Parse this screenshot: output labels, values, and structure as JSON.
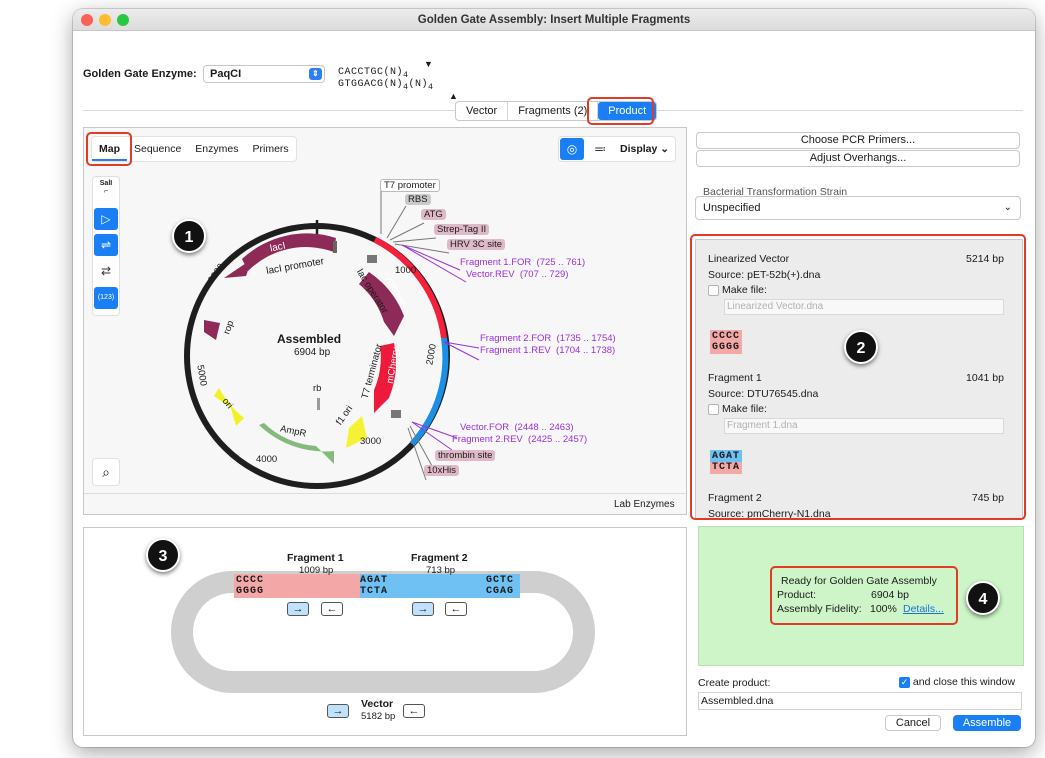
{
  "window": {
    "title": "Golden Gate Assembly: Insert Multiple Fragments"
  },
  "enzyme": {
    "label": "Golden Gate Enzyme:",
    "value": "PaqCI",
    "site_top": "CACCTGC(N)",
    "site_top_sub": "4",
    "site_bottom": "GTGGACG(N)",
    "site_bottom_sub1": "4",
    "site_bottom_mid": "(N)",
    "site_bottom_sub2": "4"
  },
  "main_tabs": [
    "Vector",
    "Fragments (2)",
    "Product"
  ],
  "view_tabs": [
    "Map",
    "Sequence",
    "Enzymes",
    "Primers"
  ],
  "display_label": "Display",
  "side_tools": {
    "sali": "SalI",
    "counter": "(123)"
  },
  "map": {
    "name": "Assembled",
    "length": "6904 bp",
    "ticks": [
      "1000",
      "2000",
      "3000",
      "4000",
      "5000",
      "6000"
    ],
    "features": {
      "laci": "lacI",
      "laci_promoter": "lacI promoter",
      "lac_operator": "lac operator",
      "xynbmat": "xynBmat",
      "mcherry": "mCherry",
      "t7_terminator": "T7 terminator",
      "f1_ori": "f1 ori",
      "ampr": "AmpR",
      "ori": "ori",
      "rop": "rop",
      "rb": "rb"
    },
    "labels_boxed": [
      "T7 promoter",
      "RBS",
      "ATG",
      "Strep-Tag II",
      "HRV 3C site",
      "thrombin site",
      "10xHis"
    ],
    "primers": [
      "Fragment 1.FOR  (725 .. 761)",
      "Vector.REV  (707 .. 729)",
      "Fragment 2.FOR  (1735 .. 1754)",
      "Fragment 1.REV  (1704 .. 1738)",
      "Vector.FOR  (2448 .. 2463)",
      "Fragment 2.REV  (2425 .. 2457)"
    ],
    "footer": "Lab Enzymes"
  },
  "right": {
    "choose_primers": "Choose PCR Primers...",
    "adjust_overhangs": "Adjust Overhangs...",
    "strain_label": "Bacterial Transformation Strain",
    "strain_value": "Unspecified"
  },
  "fragments": [
    {
      "title": "Linearized Vector",
      "size": "5214 bp",
      "source_label": "Source:",
      "source": "pET-52b(+).dna",
      "make_file": "Make file:",
      "filename": "Linearized Vector.dna",
      "overhang_top": "CCCC",
      "overhang_bottom": "GGGG",
      "color": "#f4a7a7"
    },
    {
      "title": "Fragment 1",
      "size": "1041 bp",
      "source_label": "Source:",
      "source": "DTU76545.dna",
      "make_file": "Make file:",
      "filename": "Fragment 1.dna",
      "overhang_top": "AGAT",
      "overhang_bottom": "TCTA",
      "color": "#6ec1f2"
    },
    {
      "title": "Fragment 2",
      "size": "745 bp",
      "source_label": "Source:",
      "source": "pmCherry-N1.dna"
    }
  ],
  "diagram": {
    "frag1_name": "Fragment 1",
    "frag1_size": "1009 bp",
    "frag2_name": "Fragment 2",
    "frag2_size": "713 bp",
    "oh1_top": "CCCC",
    "oh1_bottom": "GGGG",
    "oh2_top": "AGAT",
    "oh2_bottom": "TCTA",
    "oh3_top": "GCTC",
    "oh3_bottom": "CGAG",
    "vector_name": "Vector",
    "vector_size": "5182 bp"
  },
  "status": {
    "ready": "Ready for Golden Gate Assembly",
    "product_label": "Product:",
    "product_value": "6904 bp",
    "fidelity_label": "Assembly Fidelity:",
    "fidelity_value": "100%",
    "details": "Details..."
  },
  "create": {
    "label": "Create product:",
    "close_label": "and close this window",
    "filename": "Assembled.dna",
    "cancel": "Cancel",
    "assemble": "Assemble"
  },
  "badges": [
    "1",
    "2",
    "3",
    "4"
  ],
  "colors": {
    "accent": "#1a7ff5",
    "callout": "#e33a26",
    "primer": "#9b30d9",
    "ready_bg": "#cdf5c8"
  }
}
